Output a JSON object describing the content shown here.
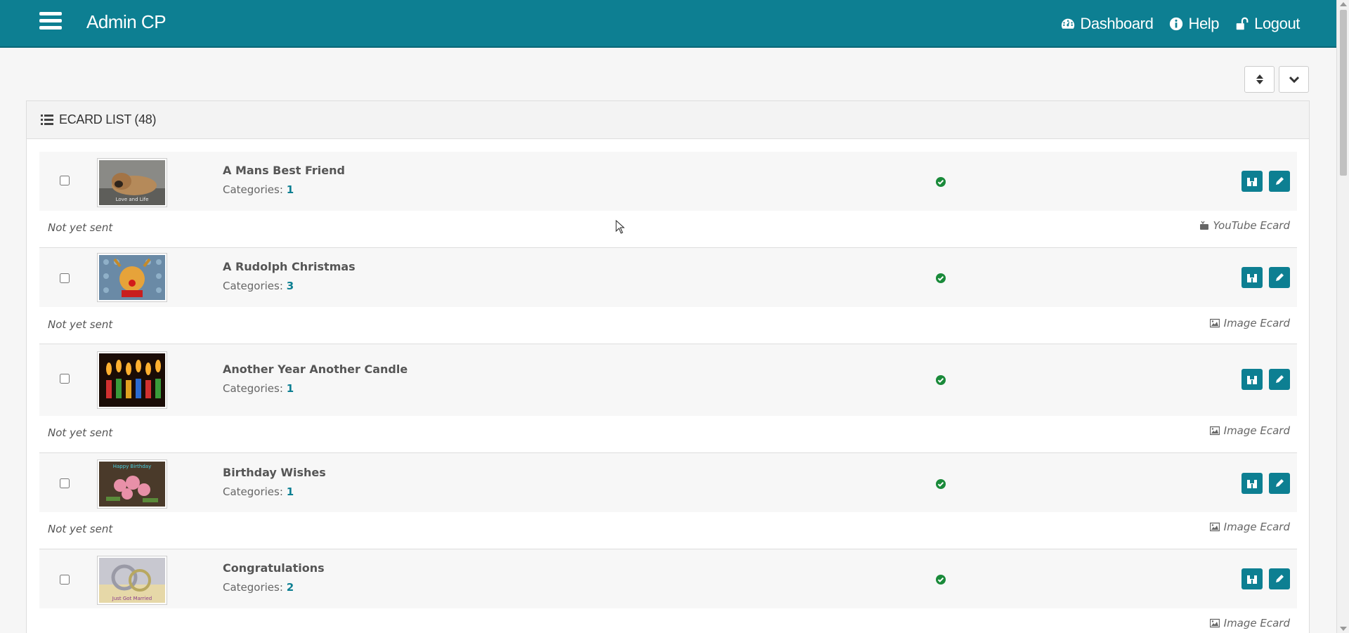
{
  "header": {
    "brand": "Admin CP",
    "nav": [
      {
        "label": "Dashboard",
        "icon": "dashboard-icon"
      },
      {
        "label": "Help",
        "icon": "info-icon"
      },
      {
        "label": "Logout",
        "icon": "unlock-icon"
      }
    ]
  },
  "toolbar": {
    "sort_icon": "sort-icon",
    "collapse_icon": "chevron-down-icon"
  },
  "panel": {
    "title": "ECARD LIST (48)"
  },
  "cards": [
    {
      "title": "A Mans Best Friend",
      "categories_label": "Categories:",
      "categories": "1",
      "sent": "Not yet sent",
      "type": "YouTube Ecard",
      "type_icon": "youtube-icon",
      "status": "active",
      "thumb_caption": "Love and Life"
    },
    {
      "title": "A Rudolph Christmas",
      "categories_label": "Categories:",
      "categories": "3",
      "sent": "Not yet sent",
      "type": "Image Ecard",
      "type_icon": "image-icon",
      "status": "active"
    },
    {
      "title": "Another Year Another Candle",
      "categories_label": "Categories:",
      "categories": "1",
      "sent": "Not yet sent",
      "type": "Image Ecard",
      "type_icon": "image-icon",
      "status": "active"
    },
    {
      "title": "Birthday Wishes",
      "categories_label": "Categories:",
      "categories": "1",
      "sent": "Not yet sent",
      "type": "Image Ecard",
      "type_icon": "image-icon",
      "status": "active",
      "thumb_caption": "Happy Birthday"
    },
    {
      "title": "Congratulations",
      "categories_label": "Categories:",
      "categories": "2",
      "sent": "",
      "type": "Image Ecard",
      "type_icon": "image-icon",
      "status": "active",
      "thumb_caption": "Just Got Married"
    }
  ],
  "colors": {
    "accent": "#0d7f92",
    "status_ok": "#1a8a3a"
  }
}
